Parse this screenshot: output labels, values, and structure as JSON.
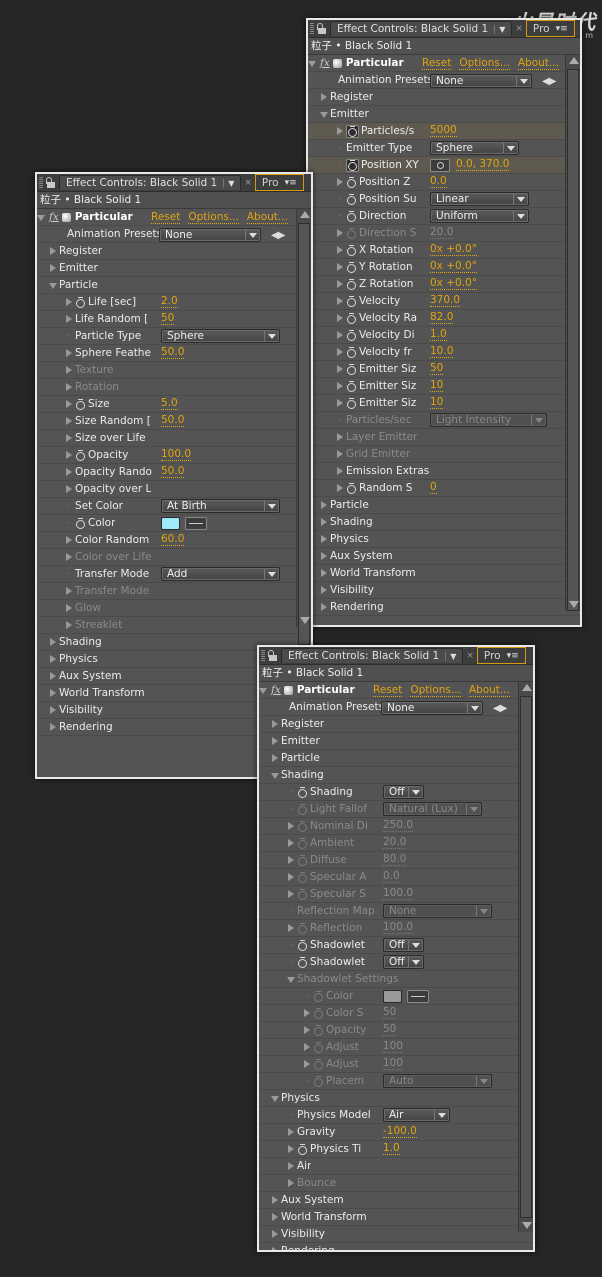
{
  "watermark": {
    "title": "火星时代",
    "url": "www.hxsd.com"
  },
  "common": {
    "tab_label": "Effect Controls: Black Solid 1",
    "tab2_label": "Pro",
    "layer_line": "粒子 • Black Solid 1",
    "effect_name": "Particular",
    "reset": "Reset",
    "options": "Options...",
    "about": "About...",
    "presets_label": "Animation Presets",
    "presets_value": "None"
  },
  "panel_emitter": {
    "rows": [
      {
        "label": "Register",
        "tw": "r",
        "indent": 1
      },
      {
        "label": "Emitter",
        "tw": "d",
        "indent": 1
      },
      {
        "label": "Particles/s",
        "tw": "r",
        "indent": 2,
        "sw": "boxed",
        "value": "5000",
        "hl": true
      },
      {
        "label": "Emitter Type",
        "tw": "n",
        "indent": 2,
        "dropdown": "Sphere",
        "ddw": 82
      },
      {
        "label": "Position XY",
        "tw": "n",
        "indent": 2,
        "sw": "boxed",
        "target": true,
        "value": "0.0, 370.0",
        "hl": true
      },
      {
        "label": "Position Z",
        "tw": "r",
        "indent": 2,
        "sw": "y",
        "value": "0.0"
      },
      {
        "label": "Position Su",
        "tw": "n",
        "indent": 2,
        "sw": "y",
        "dropdown": "Linear",
        "ddw": 92
      },
      {
        "label": "Direction",
        "tw": "n",
        "indent": 2,
        "sw": "y",
        "dropdown": "Uniform",
        "ddw": 92
      },
      {
        "label": "Direction S",
        "tw": "r",
        "indent": 2,
        "sw": "y",
        "value": "20.0",
        "dim": true
      },
      {
        "label": "X Rotation",
        "tw": "r",
        "indent": 2,
        "sw": "y",
        "value": "0x +0.0°"
      },
      {
        "label": "Y Rotation",
        "tw": "r",
        "indent": 2,
        "sw": "y",
        "value": "0x +0.0°"
      },
      {
        "label": "Z Rotation",
        "tw": "r",
        "indent": 2,
        "sw": "y",
        "value": "0x +0.0°"
      },
      {
        "label": "Velocity",
        "tw": "r",
        "indent": 2,
        "sw": "y",
        "value": "370.0"
      },
      {
        "label": "Velocity Ra",
        "tw": "r",
        "indent": 2,
        "sw": "y",
        "value": "82.0"
      },
      {
        "label": "Velocity Di",
        "tw": "r",
        "indent": 2,
        "sw": "y",
        "value": "1.0"
      },
      {
        "label": "Velocity fr",
        "tw": "r",
        "indent": 2,
        "sw": "y",
        "value": "10.0"
      },
      {
        "label": "Emitter Siz",
        "tw": "r",
        "indent": 2,
        "sw": "y",
        "value": "50"
      },
      {
        "label": "Emitter Siz",
        "tw": "r",
        "indent": 2,
        "sw": "y",
        "value": "10"
      },
      {
        "label": "Emitter Siz",
        "tw": "r",
        "indent": 2,
        "sw": "y",
        "value": "10"
      },
      {
        "label": "Particles/sec",
        "tw": "n",
        "indent": 2,
        "dropdown": "Light Intensity",
        "ddw": 110,
        "dim": true
      },
      {
        "label": "Layer Emitter",
        "tw": "r",
        "indent": 2,
        "dim": true
      },
      {
        "label": "Grid Emitter",
        "tw": "r",
        "indent": 2,
        "dim": true
      },
      {
        "label": "Emission Extras",
        "tw": "r",
        "indent": 2
      },
      {
        "label": "Random S",
        "tw": "r",
        "indent": 2,
        "sw": "y",
        "value": "0"
      },
      {
        "label": "Particle",
        "tw": "r",
        "indent": 1
      },
      {
        "label": "Shading",
        "tw": "r",
        "indent": 1
      },
      {
        "label": "Physics",
        "tw": "r",
        "indent": 1
      },
      {
        "label": "Aux System",
        "tw": "r",
        "indent": 1
      },
      {
        "label": "World Transform",
        "tw": "r",
        "indent": 1
      },
      {
        "label": "Visibility",
        "tw": "r",
        "indent": 1
      },
      {
        "label": "Rendering",
        "tw": "r",
        "indent": 1
      }
    ]
  },
  "panel_particle": {
    "rows": [
      {
        "label": "Register",
        "tw": "r",
        "indent": 1
      },
      {
        "label": "Emitter",
        "tw": "r",
        "indent": 1
      },
      {
        "label": "Particle",
        "tw": "d",
        "indent": 1
      },
      {
        "label": "Life [sec]",
        "tw": "r",
        "indent": 2,
        "sw": "y",
        "value": "2.0"
      },
      {
        "label": "Life Random [",
        "tw": "r",
        "indent": 2,
        "value": "50"
      },
      {
        "label": "Particle Type",
        "tw": "n",
        "indent": 2,
        "dropdown": "Sphere",
        "ddw": 112
      },
      {
        "label": "Sphere Feathe",
        "tw": "r",
        "indent": 2,
        "value": "50.0"
      },
      {
        "label": "Texture",
        "tw": "r",
        "indent": 2,
        "dim": true
      },
      {
        "label": "Rotation",
        "tw": "r",
        "indent": 2,
        "dim": true
      },
      {
        "label": "Size",
        "tw": "r",
        "indent": 2,
        "sw": "y",
        "value": "5.0"
      },
      {
        "label": "Size Random [",
        "tw": "r",
        "indent": 2,
        "value": "50.0"
      },
      {
        "label": "Size over Life",
        "tw": "r",
        "indent": 2
      },
      {
        "label": "Opacity",
        "tw": "r",
        "indent": 2,
        "sw": "y",
        "value": "100.0"
      },
      {
        "label": "Opacity Rando",
        "tw": "r",
        "indent": 2,
        "value": "50.0"
      },
      {
        "label": "Opacity over L",
        "tw": "r",
        "indent": 2
      },
      {
        "label": "Set Color",
        "tw": "n",
        "indent": 2,
        "dropdown": "At Birth",
        "ddw": 112
      },
      {
        "label": "Color",
        "tw": "n",
        "indent": 2,
        "sw": "y",
        "color": "#9ee9fb"
      },
      {
        "label": "Color Random",
        "tw": "r",
        "indent": 2,
        "value": "60.0"
      },
      {
        "label": "Color over Life",
        "tw": "r",
        "indent": 2,
        "dim": true
      },
      {
        "label": "Transfer Mode",
        "tw": "n",
        "indent": 2,
        "dropdown": "Add",
        "ddw": 112
      },
      {
        "label": "Transfer Mode",
        "tw": "r",
        "indent": 2,
        "dim": true
      },
      {
        "label": "Glow",
        "tw": "r",
        "indent": 2,
        "dim": true
      },
      {
        "label": "Streaklet",
        "tw": "r",
        "indent": 2,
        "dim": true
      },
      {
        "label": "Shading",
        "tw": "r",
        "indent": 1
      },
      {
        "label": "Physics",
        "tw": "r",
        "indent": 1
      },
      {
        "label": "Aux System",
        "tw": "r",
        "indent": 1
      },
      {
        "label": "World Transform",
        "tw": "r",
        "indent": 1
      },
      {
        "label": "Visibility",
        "tw": "r",
        "indent": 1
      },
      {
        "label": "Rendering",
        "tw": "r",
        "indent": 1
      }
    ]
  },
  "panel_shading": {
    "rows": [
      {
        "label": "Register",
        "tw": "r",
        "indent": 1
      },
      {
        "label": "Emitter",
        "tw": "r",
        "indent": 1
      },
      {
        "label": "Particle",
        "tw": "r",
        "indent": 1
      },
      {
        "label": "Shading",
        "tw": "d",
        "indent": 1
      },
      {
        "label": "Shading",
        "tw": "n",
        "indent": 2,
        "sw": "y",
        "dropdown": "Off",
        "ddw": 34
      },
      {
        "label": "Light Fallof",
        "tw": "n",
        "indent": 2,
        "sw": "y",
        "dropdown": "Natural (Lux)",
        "ddw": 92,
        "dim": true
      },
      {
        "label": "Nominal Di",
        "tw": "r",
        "indent": 2,
        "sw": "y",
        "value": "250.0",
        "dim": true
      },
      {
        "label": "Ambient",
        "tw": "r",
        "indent": 2,
        "sw": "y",
        "value": "20.0",
        "dim": true
      },
      {
        "label": "Diffuse",
        "tw": "r",
        "indent": 2,
        "sw": "y",
        "value": "80.0",
        "dim": true
      },
      {
        "label": "Specular A",
        "tw": "r",
        "indent": 2,
        "sw": "y",
        "value": "0.0",
        "dim": true
      },
      {
        "label": "Specular S",
        "tw": "r",
        "indent": 2,
        "sw": "y",
        "value": "100.0",
        "dim": true
      },
      {
        "label": "Reflection Map",
        "tw": "n",
        "indent": 2,
        "dropdown": "None",
        "ddw": 102,
        "dim": true
      },
      {
        "label": "Reflection",
        "tw": "r",
        "indent": 2,
        "sw": "y",
        "value": "100.0",
        "dim": true
      },
      {
        "label": "Shadowlet",
        "tw": "n",
        "indent": 2,
        "sw": "y",
        "dropdown": "Off",
        "ddw": 34
      },
      {
        "label": "Shadowlet",
        "tw": "n",
        "indent": 2,
        "sw": "y",
        "dropdown": "Off",
        "ddw": 34
      },
      {
        "label": "Shadowlet Settings",
        "tw": "d",
        "indent": 2,
        "dim": true
      },
      {
        "label": "Color",
        "tw": "n",
        "indent": 3,
        "sw": "y",
        "color": "#9a9a9a",
        "dim": true
      },
      {
        "label": "Color S",
        "tw": "r",
        "indent": 3,
        "sw": "y",
        "value": "50",
        "dim": true
      },
      {
        "label": "Opacity",
        "tw": "r",
        "indent": 3,
        "sw": "y",
        "value": "50",
        "dim": true
      },
      {
        "label": "Adjust",
        "tw": "r",
        "indent": 3,
        "sw": "y",
        "value": "100",
        "dim": true
      },
      {
        "label": "Adjust",
        "tw": "r",
        "indent": 3,
        "sw": "y",
        "value": "100",
        "dim": true
      },
      {
        "label": "Placem",
        "tw": "n",
        "indent": 3,
        "sw": "y",
        "dropdown": "Auto",
        "ddw": 102,
        "dim": true
      },
      {
        "label": "Physics",
        "tw": "d",
        "indent": 1
      },
      {
        "label": "Physics Model",
        "tw": "n",
        "indent": 2,
        "dropdown": "Air",
        "ddw": 60
      },
      {
        "label": "Gravity",
        "tw": "r",
        "indent": 2,
        "value": "-100.0"
      },
      {
        "label": "Physics Ti",
        "tw": "r",
        "indent": 2,
        "sw": "y",
        "value": "1.0"
      },
      {
        "label": "Air",
        "tw": "r",
        "indent": 2
      },
      {
        "label": "Bounce",
        "tw": "r",
        "indent": 2,
        "dim": true
      },
      {
        "label": "Aux System",
        "tw": "r",
        "indent": 1
      },
      {
        "label": "World Transform",
        "tw": "r",
        "indent": 1
      },
      {
        "label": "Visibility",
        "tw": "r",
        "indent": 1
      },
      {
        "label": "Rendering",
        "tw": "r",
        "indent": 1
      }
    ]
  }
}
